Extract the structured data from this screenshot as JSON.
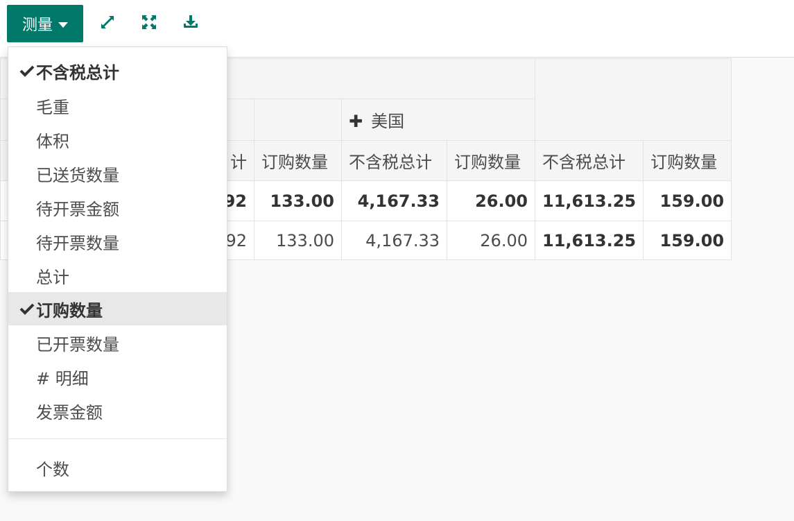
{
  "toolbar": {
    "measure_label": "测量",
    "expand_icon": "expand-arrows-icon",
    "expand_all_icon": "expand-all-icon",
    "download_icon": "download-icon",
    "accent_color": "#00796b"
  },
  "pivot": {
    "group_header": "美国",
    "columns": [
      "计",
      "订购数量",
      "不含税总计",
      "订购数量",
      "不含税总计",
      "订购数量"
    ],
    "total_row": [
      "92",
      "133.00",
      "4,167.33",
      "26.00",
      "11,613.25",
      "159.00"
    ],
    "data_row": [
      "92",
      "133.00",
      "4,167.33",
      "26.00",
      "11,613.25",
      "159.00"
    ]
  },
  "measures_menu": {
    "items": [
      {
        "label": "不含税总计",
        "selected": true
      },
      {
        "label": "毛重",
        "selected": false
      },
      {
        "label": "体积",
        "selected": false
      },
      {
        "label": "已送货数量",
        "selected": false
      },
      {
        "label": "待开票金额",
        "selected": false
      },
      {
        "label": "待开票数量",
        "selected": false
      },
      {
        "label": "总计",
        "selected": false
      },
      {
        "label": "订购数量",
        "selected": true
      },
      {
        "label": "已开票数量",
        "selected": false
      },
      {
        "label": "# 明细",
        "selected": false
      },
      {
        "label": "发票金额",
        "selected": false
      }
    ],
    "count_label": "个数"
  }
}
